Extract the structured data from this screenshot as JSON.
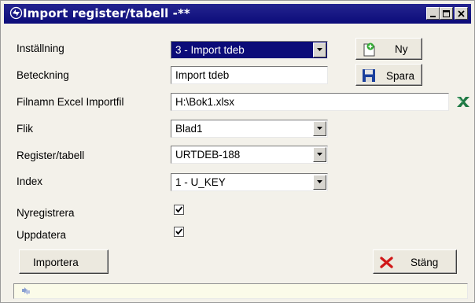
{
  "window": {
    "title": "Import register/tabell -**",
    "controls": [
      "minimize-icon",
      "maximize-icon",
      "close-icon"
    ]
  },
  "form": {
    "installning": {
      "label": "Inställning",
      "value": "3 - Import tdeb"
    },
    "beteckning": {
      "label": "Beteckning",
      "value": "Import tdeb"
    },
    "filnamn": {
      "label": "Filnamn Excel Importfil",
      "value": "H:\\Bok1.xlsx"
    },
    "flik": {
      "label": "Flik",
      "value": "Blad1"
    },
    "register": {
      "label": "Register/tabell",
      "value": "URTDEB-188"
    },
    "index": {
      "label": "Index",
      "value": "1 - U_KEY"
    },
    "nyregistrera": {
      "label": "Nyregistrera",
      "checked": true
    },
    "uppdatera": {
      "label": "Uppdatera",
      "checked": true
    }
  },
  "buttons": {
    "ny": "Ny",
    "spara": "Spara",
    "importera": "Importera",
    "stang": "Stäng"
  },
  "colors": {
    "titlebar": "#0c0c79",
    "selection": "#0c0c79",
    "excel_icon": "#1f7a45",
    "save_icon": "#1a3f9c",
    "close_x": "#d01818"
  }
}
